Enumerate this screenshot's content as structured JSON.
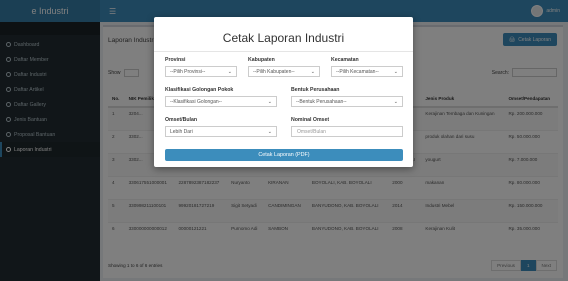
{
  "app": {
    "brand": "e Industri",
    "user": "admin"
  },
  "sidebar": {
    "items": [
      {
        "label": "Dashboard"
      },
      {
        "label": "Daftar Member"
      },
      {
        "label": "Daftar Industri"
      },
      {
        "label": "Daftar Artikel"
      },
      {
        "label": "Daftar Gallery"
      },
      {
        "label": "Jenis Bantuan"
      },
      {
        "label": "Proposal Bantuan"
      },
      {
        "label": "Laporan Industri"
      }
    ]
  },
  "page": {
    "title": "Laporan Industri",
    "print_button": "Cetak Laporan",
    "show_label": "Show",
    "show_value": "10",
    "search_label": "Search:",
    "columns": [
      "No.",
      "NIK Pemilik",
      "NIB",
      "NPWP",
      "Nama Pemilik",
      "Nama Usaha",
      "Alamat",
      "Tahun Berdiri",
      "Jenis Produk",
      "Omset/Pendapatan"
    ],
    "rows": [
      [
        "1",
        "3204...",
        "",
        "",
        "",
        "",
        "",
        "",
        "Kerajinan Tembaga dan Kuningan",
        "Rp. 200.000.000"
      ],
      [
        "2",
        "3302...",
        "",
        "",
        "",
        "",
        "",
        "",
        "produk olahan dari susu",
        "Rp. 50.000.000"
      ],
      [
        "3",
        "3302...",
        "...",
        "",
        "",
        "",
        "BOYOLALI",
        "",
        "yougurt",
        "Rp. 7.000.000"
      ],
      [
        "4",
        "330617551000001",
        "2287892387182237",
        "Nuryanto",
        "KIRANAN",
        "BOYOLALI, KAB. BOYOLALI",
        "2000",
        "makanan",
        "Rp. 80.000.000",
        ""
      ],
      [
        "5",
        "330998211100101",
        "99920181727219",
        "Sigit Setyadi",
        "CANDIMINGAN",
        "BANYUDONO, KAB. BOYOLALI",
        "2014",
        "Industri Mebel",
        "Rp. 150.000.000",
        ""
      ],
      [
        "6",
        "330000000000012",
        "00000121221",
        "Purnomo Adi",
        "SAMBON",
        "BANYUDONO, KAB. BOYOLALI",
        "2008",
        "Kerajinan Kulit",
        "Rp. 35.000.000",
        ""
      ]
    ],
    "footer_info": "Showing 1 to 6 of 6 entries",
    "pager": {
      "prev": "Previous",
      "current": "1",
      "next": "Next"
    }
  },
  "modal": {
    "title": "Cetak Laporan Industri",
    "provinsi": {
      "label": "Provinsi",
      "value": "--Pilih Provinsi--"
    },
    "kabupaten": {
      "label": "Kabupaten",
      "value": "--Pilih Kabupaten--"
    },
    "kecamatan": {
      "label": "Kecamatan",
      "value": "--Pilih Kecamatan--"
    },
    "golongan": {
      "label": "Klasifikasi Golongan Pokok",
      "value": "--Klasifikasi Golongan--"
    },
    "bentuk": {
      "label": "Bentuk Perusahaan",
      "value": "--Bentuk Perusahaan--"
    },
    "omset": {
      "label": "Omset/Bulan",
      "value": "Lebih Dari"
    },
    "nominal": {
      "label": "Nominal Omset",
      "placeholder": "Omset/Bulan"
    },
    "submit": "Cetak Laporan (PDF)"
  },
  "colors": {
    "primary": "#3c8dbc",
    "sidebar": "#222d32"
  }
}
